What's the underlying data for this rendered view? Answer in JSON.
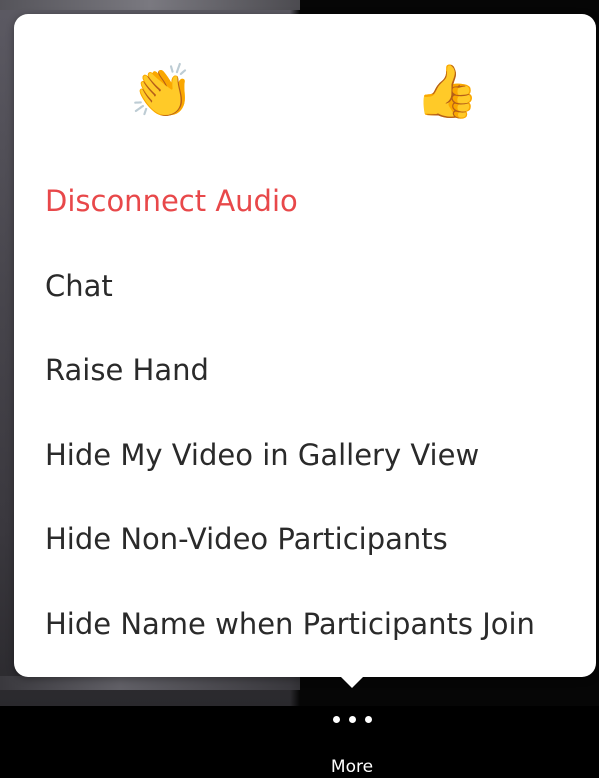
{
  "reactions": [
    {
      "icon": "clapping-hands-icon",
      "glyph": "👏"
    },
    {
      "icon": "thumbs-up-icon",
      "glyph": "👍"
    }
  ],
  "menu": {
    "items": [
      {
        "label": "Disconnect Audio",
        "color": "#e8484a"
      },
      {
        "label": "Chat"
      },
      {
        "label": "Raise Hand"
      },
      {
        "label": "Hide My Video in Gallery View"
      },
      {
        "label": "Hide Non-Video Participants"
      },
      {
        "label": "Hide Name when Participants Join"
      }
    ]
  },
  "toolbar": {
    "more_label": "More",
    "more_icon": "more-dots-icon"
  },
  "colors": {
    "danger": "#e8484a",
    "popup_bg": "#ffffff",
    "toolbar_bg": "#000000"
  }
}
